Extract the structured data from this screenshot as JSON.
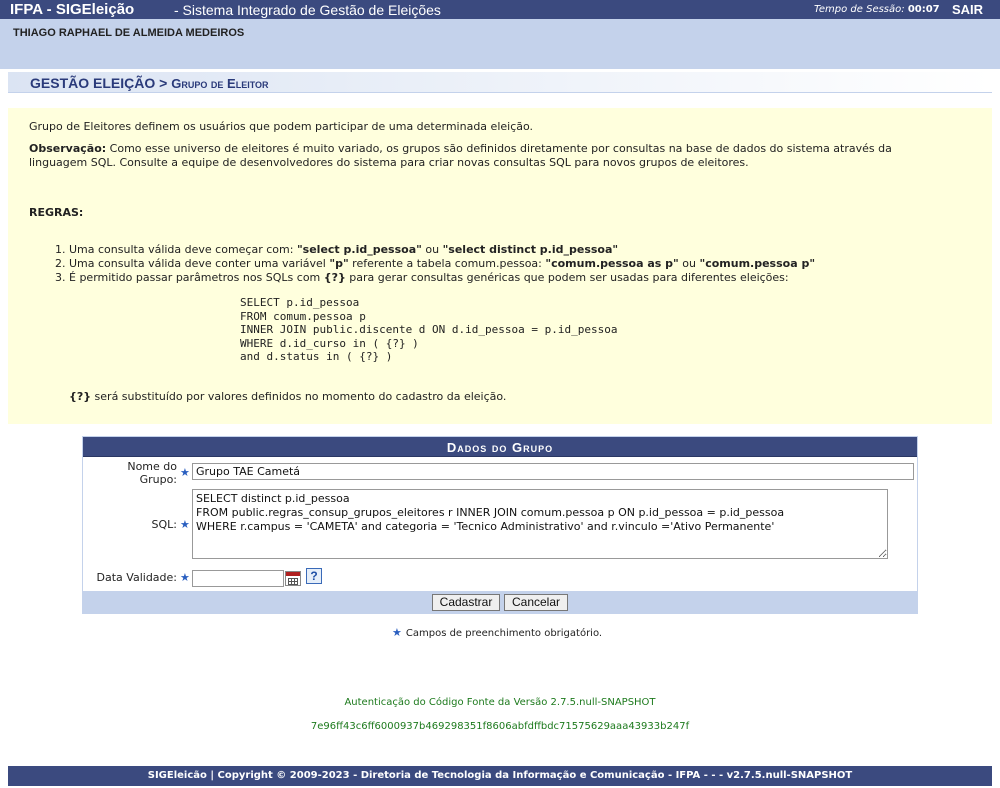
{
  "header": {
    "system_name": "IFPA - SIGEleição",
    "subtitle": "- Sistema Integrado de Gestão de Eleições",
    "session_label": "Tempo de Sessão:",
    "session_time": "00:07",
    "logout_label": "SAIR"
  },
  "user": {
    "name": "THIAGO RAPHAEL DE ALMEIDA MEDEIROS"
  },
  "page_title": {
    "module": "GESTÃO ELEIÇÃO",
    "separator": ">",
    "page": "Grupo de Eleitor"
  },
  "description": {
    "intro": "Grupo de Eleitores definem os usuários que podem participar de uma determinada eleição.",
    "obs_label": "Observação:",
    "obs_text": " Como esse universo de eleitores é muito variado, os grupos são definidos diretamente por consultas na base de dados do sistema através da linguagem SQL. Consulte a equipe de desenvolvedores do sistema para criar novas consultas SQL para novos grupos de eleitores.",
    "rules_heading": "REGRAS:",
    "rules": [
      {
        "a": "Uma consulta válida deve começar com: ",
        "b": "\"select p.id_pessoa\"",
        "c": " ou ",
        "d": "\"select distinct p.id_pessoa\"",
        "e": ""
      },
      {
        "a": "Uma consulta válida deve conter uma variável ",
        "b": "\"p\"",
        "c": " referente a tabela comum.pessoa: ",
        "d": "\"comum.pessoa as p\"",
        "e": " ou ",
        "f": "\"comum.pessoa p\""
      },
      {
        "a": "É permitido passar parâmetros nos SQLs com ",
        "b": "{?}",
        "c": " para gerar consultas genéricas que podem ser usadas para diferentes eleições:"
      }
    ],
    "sql_example": "SELECT p.id_pessoa\nFROM comum.pessoa p\nINNER JOIN public.discente d ON d.id_pessoa = p.id_pessoa\nWHERE d.id_curso in ( {?} )\nand d.status in ( {?} )",
    "note_token": "{?}",
    "note_text": " será substituído por valores definidos no momento do cadastro da eleição."
  },
  "form": {
    "caption": "Dados do Grupo",
    "required_mark": "★",
    "name_label_1": "Nome do",
    "name_label_2": "Grupo:",
    "name_value": "Grupo TAE Cametá",
    "sql_label": "SQL:",
    "sql_value": "SELECT distinct p.id_pessoa\nFROM public.regras_consup_grupos_eleitores r INNER JOIN comum.pessoa p ON p.id_pessoa = p.id_pessoa\nWHERE r.campus = 'CAMETA' and categoria = 'Tecnico Administrativo' and r.vinculo ='Ativo Permanente'",
    "date_label": "Data Validade:",
    "date_value": "",
    "help_label": "?",
    "submit_label": "Cadastrar",
    "cancel_label": "Cancelar"
  },
  "required_note": "Campos de preenchimento obrigatório.",
  "auth": {
    "line1": "Autenticação do Código Fonte da Versão 2.7.5.null-SNAPSHOT",
    "line2": "7e96ff43c6ff6000937b469298351f8606abfdffbdc71575629aaa43933b247f"
  },
  "footer": "SIGEleicão | Copyright © 2009-2023 - Diretoria de Tecnologia da Informação e Comunicação - IFPA - - - v2.7.5.null-SNAPSHOT",
  "colors": {
    "header_bg": "#3b4a7f",
    "band_bg": "#c4d2eb",
    "info_bg": "#ffffdd",
    "auth_text": "#1d7a1d"
  }
}
